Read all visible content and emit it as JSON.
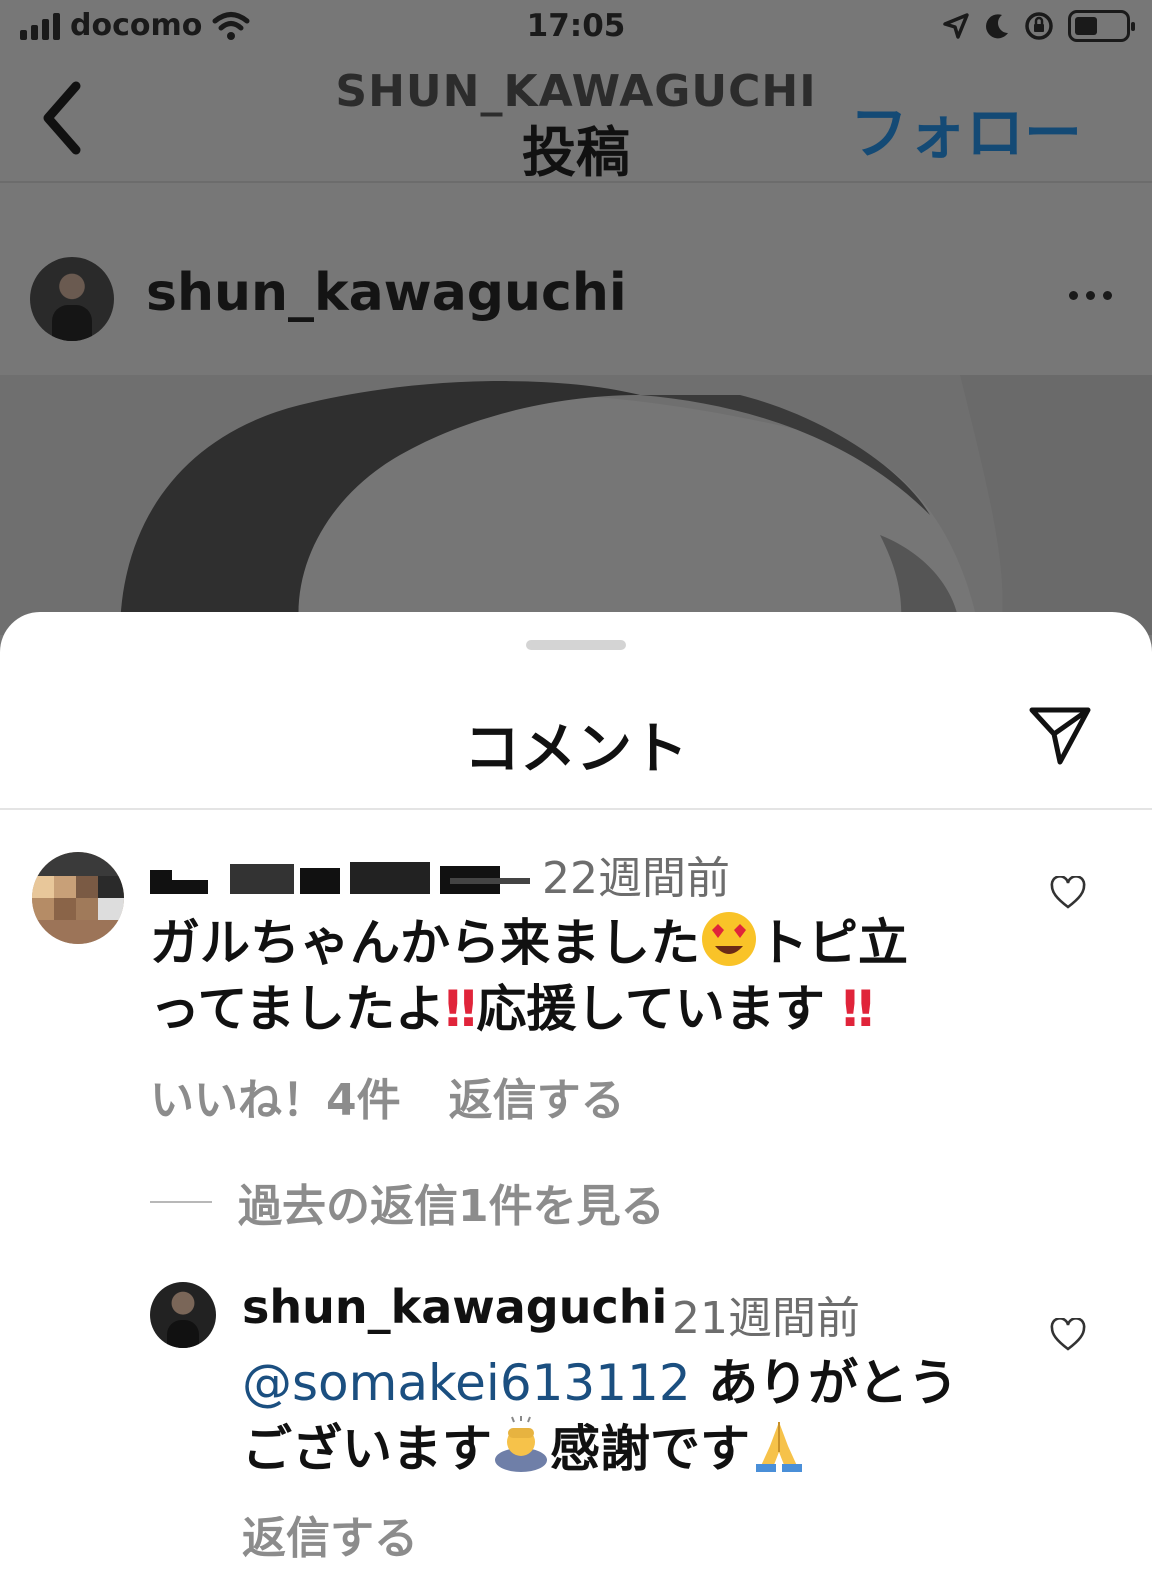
{
  "status_bar": {
    "carrier": "docomo",
    "time": "17:05"
  },
  "nav": {
    "subtitle": "SHUN_KAWAGUCHI",
    "title": "投稿",
    "follow_label": "フォロー"
  },
  "post": {
    "username": "shun_kawaguchi"
  },
  "sheet": {
    "title": "コメント"
  },
  "comments": [
    {
      "time": "22週間前",
      "text_line1": "ガルちゃんから来ました",
      "text_line1b": "トピ立",
      "text_line2a": "ってましたよ",
      "text_line2b": "応援しています",
      "likes": "いいね！4件",
      "reply_label": "返信する"
    }
  ],
  "view_replies_label": "過去の返信1件を見る",
  "reply": {
    "username": "shun_kawaguchi",
    "time": "21週間前",
    "mention": "@somakei613112",
    "text_line1": " ありがとう",
    "text_line2a": "ございます",
    "text_line2b": "感謝です",
    "reply_label": "返信する"
  },
  "colors": {
    "follow": "#144a75",
    "mention": "#1b4f80",
    "meta": "#8c8c8c"
  }
}
